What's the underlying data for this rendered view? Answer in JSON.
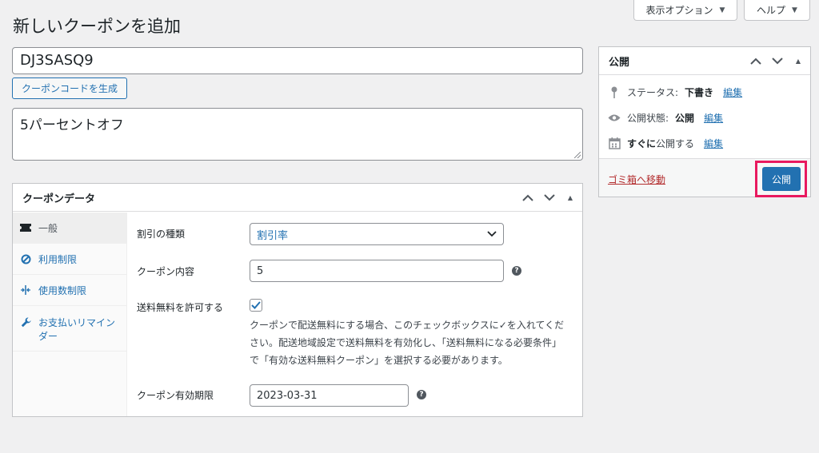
{
  "screen_options": {
    "display_label": "表示オプション",
    "help_label": "ヘルプ"
  },
  "page_title": "新しいクーポンを追加",
  "coupon_code": {
    "value": "DJ3SASQ9",
    "generate_label": "クーポンコードを生成"
  },
  "description": {
    "value": "5パーセントオフ"
  },
  "coupon_data": {
    "title": "クーポンデータ",
    "tabs": [
      {
        "label": "一般",
        "icon": "ticket-icon",
        "active": true
      },
      {
        "label": "利用制限",
        "icon": "prohibited-icon",
        "active": false
      },
      {
        "label": "使用数制限",
        "icon": "limits-icon",
        "active": false
      },
      {
        "label": "お支払いリマインダー",
        "icon": "wrench-icon",
        "active": false
      }
    ],
    "fields": {
      "discount_type_label": "割引の種類",
      "discount_type_value": "割引率",
      "amount_label": "クーポン内容",
      "amount_value": "5",
      "free_shipping_label": "送料無料を許可する",
      "free_shipping_checked": true,
      "free_shipping_desc": "クーポンで配送無料にする場合、このチェックボックスに✓を入れてください。配送地域設定で送料無料を有効化し、「送料無料になる必要条件」で「有効な送料無料クーポン」を選択する必要があります。",
      "expiry_label": "クーポン有効期限",
      "expiry_value": "2023-03-31"
    }
  },
  "publish": {
    "title": "公開",
    "status_label": "ステータス:",
    "status_value": "下書き",
    "visibility_label": "公開状態:",
    "visibility_value": "公開",
    "schedule_prefix": "すぐに",
    "schedule_suffix": "公開する",
    "edit_label": "編集",
    "trash_label": "ゴミ箱へ移動",
    "publish_button": "公開"
  },
  "colors": {
    "accent": "#2271b1",
    "highlight": "#e8195f",
    "trash": "#b32d2e",
    "background": "#f0f0f1"
  }
}
